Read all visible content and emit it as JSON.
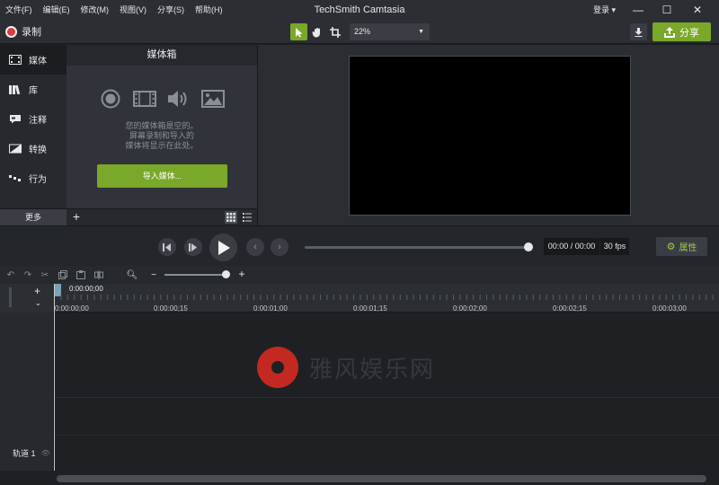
{
  "menu": [
    "文件(F)",
    "编辑(E)",
    "修改(M)",
    "视图(V)",
    "分享(S)",
    "帮助(H)"
  ],
  "app_title": "TechSmith Camtasia",
  "login_label": "登录 ▾",
  "window_controls": {
    "minimize": "—",
    "maximize": "☐",
    "close": "✕"
  },
  "toolbar": {
    "record_label": "录制",
    "zoom_value": "22%",
    "share_label": "分享"
  },
  "sidebar": {
    "items": [
      {
        "label": "媒体",
        "icon": "media-icon"
      },
      {
        "label": "库",
        "icon": "library-icon"
      },
      {
        "label": "注释",
        "icon": "annotation-icon"
      },
      {
        "label": "转换",
        "icon": "transition-icon"
      },
      {
        "label": "行为",
        "icon": "behavior-icon"
      }
    ],
    "more_label": "更多"
  },
  "media_bin": {
    "title": "媒体箱",
    "empty_line1": "您的媒体箱是空的。",
    "empty_line2": "屏幕录制和导入的",
    "empty_line3": "媒体将显示在此处。",
    "import_label": "导入媒体..."
  },
  "playback": {
    "timecode": "00:00 / 00:00",
    "fps": "30 fps",
    "properties_label": "属性"
  },
  "timeline": {
    "playhead_time": "0:00:00;00",
    "ticks": [
      "0:00:00;00",
      "0:00:00;15",
      "0:00:01;00",
      "0:00:01;15",
      "0:00:02;00",
      "0:00:02;15",
      "0:00:03;00"
    ],
    "track_label": "轨道 1"
  },
  "watermark": {
    "text": "雅风娱乐网"
  },
  "colors": {
    "accent": "#7aa82a",
    "record": "#e03a3a",
    "watermark": "#e02b20"
  }
}
